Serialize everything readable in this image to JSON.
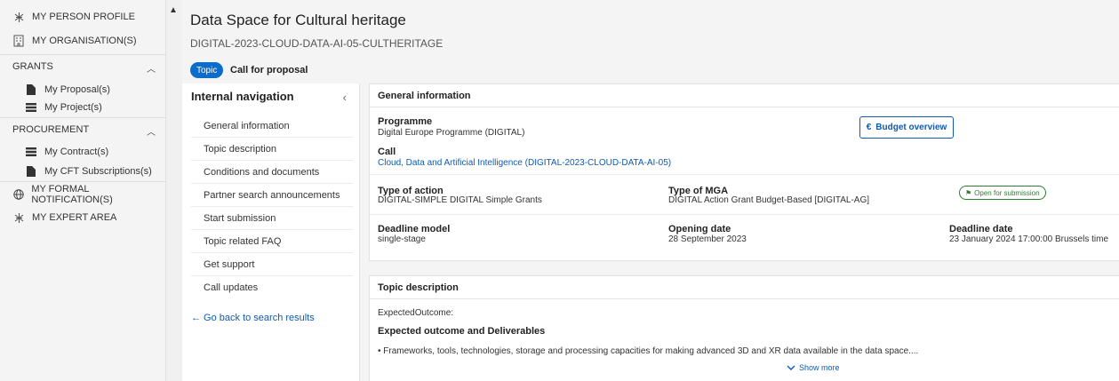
{
  "sidebar": {
    "person_profile": "MY PERSON PROFILE",
    "organisation": "MY ORGANISATION(S)",
    "grants": {
      "label": "GRANTS",
      "items": [
        "My Proposal(s)",
        "My Project(s)"
      ]
    },
    "procurement": {
      "label": "PROCUREMENT",
      "items": [
        "My Contract(s)",
        "My CFT Subscriptions(s)"
      ]
    },
    "formal_notification": "MY FORMAL NOTIFICATION(S)",
    "expert_area": "MY EXPERT AREA"
  },
  "header": {
    "title": "Data Space for Cultural heritage",
    "code": "DIGITAL-2023-CLOUD-DATA-AI-05-CULTHERITAGE",
    "pill": "Topic",
    "type": "Call for proposal"
  },
  "internal_nav": {
    "title": "Internal navigation",
    "items": [
      "General information",
      "Topic description",
      "Conditions and documents",
      "Partner search announcements",
      "Start submission",
      "Topic related FAQ",
      "Get support",
      "Call updates"
    ],
    "back": "← Go back to search results"
  },
  "general_info": {
    "heading": "General information",
    "programme_label": "Programme",
    "programme_value": "Digital Europe Programme (DIGITAL)",
    "budget_button": "Budget overview",
    "call_label": "Call",
    "call_value": "Cloud, Data and Artificial Intelligence (DIGITAL-2023-CLOUD-DATA-AI-05)",
    "type_action_label": "Type of action",
    "type_action_value": "DIGITAL-SIMPLE DIGITAL Simple Grants",
    "type_mga_label": "Type of MGA",
    "type_mga_value": "DIGITAL Action Grant Budget-Based [DIGITAL-AG]",
    "status": "Open for submission",
    "deadline_model_label": "Deadline model",
    "deadline_model_value": "single-stage",
    "opening_label": "Opening date",
    "opening_value": "28 September 2023",
    "deadline_label": "Deadline date",
    "deadline_value": "23 January 2024 17:00:00 Brussels time"
  },
  "topic_description": {
    "heading": "Topic description",
    "expected_outcome": "ExpectedOutcome:",
    "subheading": "Expected outcome and Deliverables",
    "bullet": "• Frameworks, tools, technologies, storage and processing capacities for making advanced 3D and XR data available in the data space....",
    "show_more": "Show more"
  },
  "colors": {
    "accent": "#0d5bb5",
    "pill": "#0d6bc9",
    "status": "#2e7d32"
  }
}
